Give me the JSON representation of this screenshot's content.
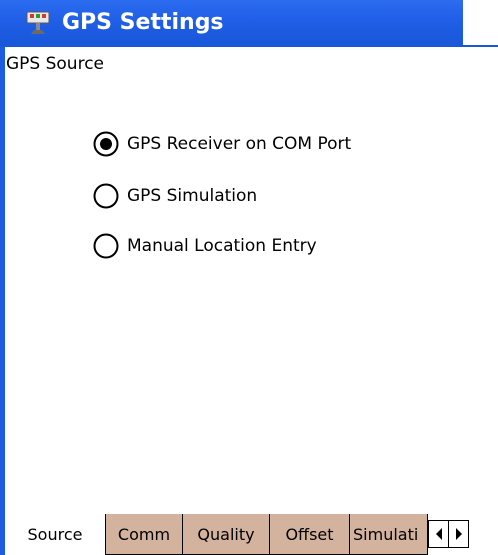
{
  "window": {
    "title": "GPS Settings"
  },
  "page": {
    "title": "GPS Source"
  },
  "radio_group": {
    "options": [
      {
        "label": "GPS Receiver on COM Port",
        "selected": true
      },
      {
        "label": "GPS Simulation",
        "selected": false
      },
      {
        "label": "Manual Location Entry",
        "selected": false
      }
    ]
  },
  "tabs": {
    "items": [
      {
        "label": "Source",
        "active": true
      },
      {
        "label": "Comm",
        "active": false
      },
      {
        "label": "Quality",
        "active": false
      },
      {
        "label": "Offset",
        "active": false
      },
      {
        "label": "Simulati",
        "active": false
      }
    ],
    "scroll_left_icon": "triangle-left",
    "scroll_right_icon": "triangle-right"
  },
  "colors": {
    "title_bar": "#1f5ee6",
    "inactive_tab": "#d4b39e",
    "active_tab": "#ffffff"
  }
}
